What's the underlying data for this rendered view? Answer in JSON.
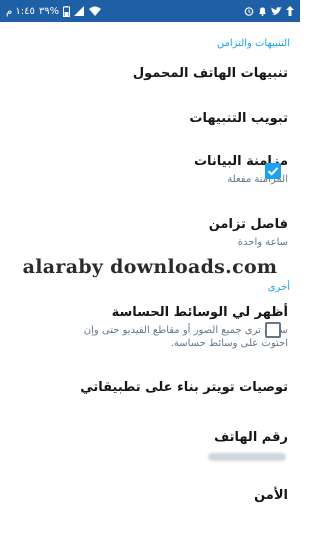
{
  "status_bar": {
    "time": "١:٤٥ م",
    "battery": "٣٩%",
    "bg_color": "#1f5fa6"
  },
  "sections": {
    "notifications_sync": "التنبيهات والتزامن",
    "other": "أخرى"
  },
  "rows": {
    "mobile_notifications": {
      "title": "تنبيهات الهاتف المحمول"
    },
    "notification_tab": {
      "title": "تبويب التنبيهات"
    },
    "data_sync": {
      "title": "مزامنة البيانات",
      "subtitle": "المزامنة مفعلة",
      "checked": true
    },
    "sync_interval": {
      "title": "فاصل تزامن",
      "subtitle": "ساعة واحدة"
    },
    "sensitive_media": {
      "title": "أظهر لي الوسائط الحساسة",
      "subtitle": "سوف ترى جميع الصور أو مقاطع الفيديو حتى وإن احتوت على وسائط حساسة.",
      "checked": false
    },
    "recommendations": {
      "title": "توصيات تويتر بناء على تطبيقاتي"
    },
    "phone_number": {
      "title": "رقم الهاتف"
    },
    "security": {
      "title": "الأمن"
    }
  },
  "watermark": "alaraby downloads.com",
  "accent_color": "#1da1f2"
}
